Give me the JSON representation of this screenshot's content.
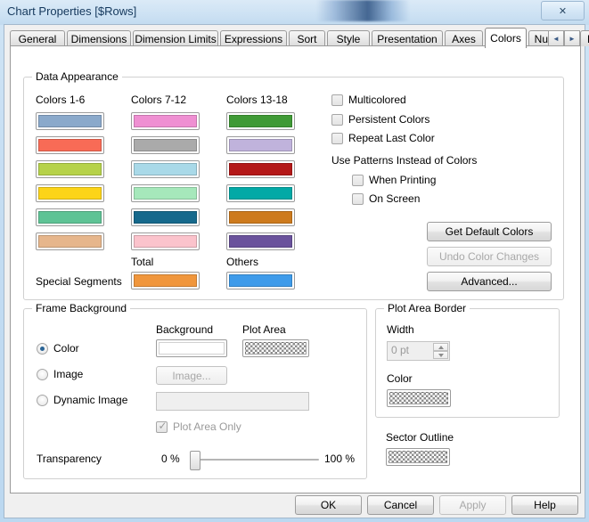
{
  "window": {
    "title": "Chart Properties [$Rows]",
    "close_label": "✕"
  },
  "tabs": [
    {
      "label": "General",
      "active": false
    },
    {
      "label": "Dimensions",
      "active": false
    },
    {
      "label": "Dimension Limits",
      "active": false
    },
    {
      "label": "Expressions",
      "active": false
    },
    {
      "label": "Sort",
      "active": false
    },
    {
      "label": "Style",
      "active": false
    },
    {
      "label": "Presentation",
      "active": false
    },
    {
      "label": "Axes",
      "active": false
    },
    {
      "label": "Colors",
      "active": true
    },
    {
      "label": "Number",
      "active": false
    },
    {
      "label": "Font",
      "active": false
    }
  ],
  "tab_nav": {
    "prev": "◄",
    "next": "►"
  },
  "data_appearance": {
    "legend": "Data Appearance",
    "col1_label": "Colors 1-6",
    "col2_label": "Colors 7-12",
    "col3_label": "Colors 13-18",
    "special_segments_label": "Special Segments",
    "total_label": "Total",
    "others_label": "Others",
    "colors_1_6": [
      "#8aa9cb",
      "#f86b56",
      "#b6d24a",
      "#fcd418",
      "#5ec395",
      "#e6b68c"
    ],
    "colors_7_12": [
      "#ef8fd2",
      "#aaaaaa",
      "#a9d9e8",
      "#a6e8bb",
      "#16698c",
      "#fbc3cc"
    ],
    "colors_13_18": [
      "#3f9a35",
      "#c0b3dc",
      "#b41818",
      "#02a9a6",
      "#cd7a1d",
      "#6a529c"
    ],
    "total_color": "#f0963c",
    "others_color": "#3e9bea",
    "checkboxes": [
      {
        "label": "Multicolored",
        "checked": false
      },
      {
        "label": "Persistent Colors",
        "checked": false
      },
      {
        "label": "Repeat Last Color",
        "checked": false
      }
    ],
    "patterns_label": "Use Patterns Instead of Colors",
    "pattern_checkboxes": [
      {
        "label": "When Printing",
        "checked": false
      },
      {
        "label": "On Screen",
        "checked": false
      }
    ],
    "buttons": [
      {
        "label": "Get Default Colors",
        "disabled": false
      },
      {
        "label": "Undo Color Changes",
        "disabled": true
      },
      {
        "label": "Advanced...",
        "disabled": false
      }
    ]
  },
  "frame_background": {
    "legend": "Frame Background",
    "background_label": "Background",
    "plot_area_label": "Plot Area",
    "radios": [
      {
        "label": "Color",
        "selected": true
      },
      {
        "label": "Image",
        "selected": false
      },
      {
        "label": "Dynamic Image",
        "selected": false
      }
    ],
    "image_button_label": "Image...",
    "dynamic_image_value": "",
    "plot_area_only_label": "Plot Area Only",
    "plot_area_only_checked": true,
    "transparency_label": "Transparency",
    "transparency_min_label": "0 %",
    "transparency_max_label": "100 %",
    "transparency_value": 0
  },
  "plot_area_border": {
    "legend": "Plot Area Border",
    "width_label": "Width",
    "width_value": "0 pt",
    "color_label": "Color",
    "sector_outline_label": "Sector Outline"
  },
  "dialog_buttons": [
    {
      "label": "OK",
      "disabled": false
    },
    {
      "label": "Cancel",
      "disabled": false
    },
    {
      "label": "Apply",
      "disabled": true
    },
    {
      "label": "Help",
      "disabled": false
    }
  ]
}
